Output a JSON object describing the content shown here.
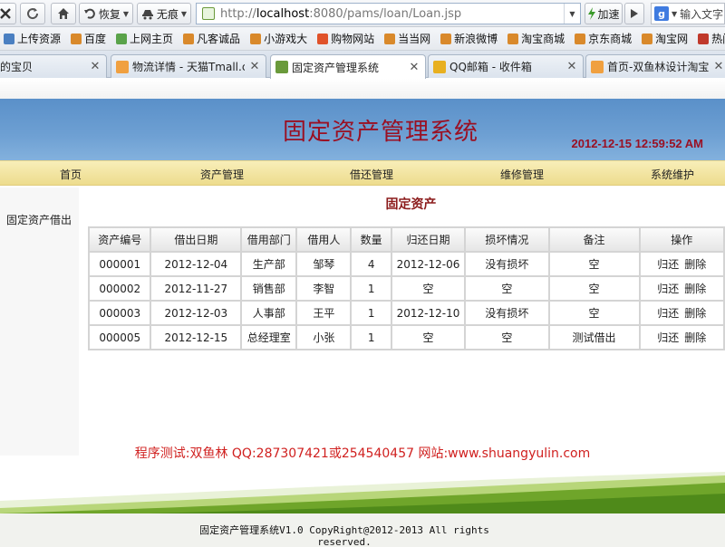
{
  "browser": {
    "back_label": "",
    "restore_label": "恢复",
    "incognito_label": "无痕",
    "address": {
      "prefix": "http://",
      "host": "localhost",
      "rest": ":8080/pams/loan/Loan.jsp"
    },
    "accelerate_label": "加速",
    "search_placeholder": "输入文字"
  },
  "bookmarks": [
    {
      "label": "上传资源",
      "color": "#4a7fc1"
    },
    {
      "label": "百度",
      "color": "#d9892b"
    },
    {
      "label": "上网主页",
      "color": "#5aa34a"
    },
    {
      "label": "凡客诚品",
      "color": "#d9892b"
    },
    {
      "label": "小游戏大",
      "color": "#d9892b"
    },
    {
      "label": "购物网站",
      "color": "#e0522a"
    },
    {
      "label": "当当网",
      "color": "#d9892b"
    },
    {
      "label": "新浪微博",
      "color": "#d9892b"
    },
    {
      "label": "淘宝商城",
      "color": "#d9892b"
    },
    {
      "label": "京东商城",
      "color": "#d9892b"
    },
    {
      "label": "淘宝网",
      "color": "#d9892b"
    },
    {
      "label": "热门游戏",
      "color": "#c0392b"
    }
  ],
  "tabs": [
    {
      "title": "的宝贝",
      "active": false,
      "color": "#f0a040"
    },
    {
      "title": "物流详情 - 天猫Tmall.c...",
      "active": false,
      "color": "#f0a040"
    },
    {
      "title": "固定资产管理系统",
      "active": true,
      "color": "#6a9a3b"
    },
    {
      "title": "QQ邮箱 - 收件箱",
      "active": false,
      "color": "#e8b020"
    },
    {
      "title": "首页-双鱼林设计淘宝店...",
      "active": false,
      "color": "#f0a040"
    }
  ],
  "header": {
    "title": "固定资产管理系统",
    "datetime": "2012-12-15 12:59:52 AM"
  },
  "nav": [
    "首页",
    "资产管理",
    "借还管理",
    "维修管理",
    "系统维护"
  ],
  "sidebar": {
    "link": "固定资产借出"
  },
  "content_title": "固定资产",
  "table": {
    "headers": [
      "资产编号",
      "借出日期",
      "借用部门",
      "借用人",
      "数量",
      "归还日期",
      "损坏情况",
      "备注",
      "操作"
    ],
    "rows": [
      [
        "000001",
        "2012-12-04",
        "生产部",
        "邹琴",
        "4",
        "2012-12-06",
        "没有损坏",
        "空"
      ],
      [
        "000002",
        "2012-11-27",
        "销售部",
        "李智",
        "1",
        "空",
        "空",
        "空"
      ],
      [
        "000003",
        "2012-12-03",
        "人事部",
        "王平",
        "1",
        "2012-12-10",
        "没有损坏",
        "空"
      ],
      [
        "000005",
        "2012-12-15",
        "总经理室",
        "小张",
        "1",
        "空",
        "空",
        "测试借出"
      ]
    ],
    "actions": [
      "归还",
      "删除"
    ]
  },
  "credit": "程序测试:双鱼林 QQ:287307421或254540457 网站:www.shuangyulin.com",
  "footer": {
    "line1": "固定资产管理系统V1.0 CopyRight@2012-2013 All rights",
    "line2": "reserved."
  }
}
